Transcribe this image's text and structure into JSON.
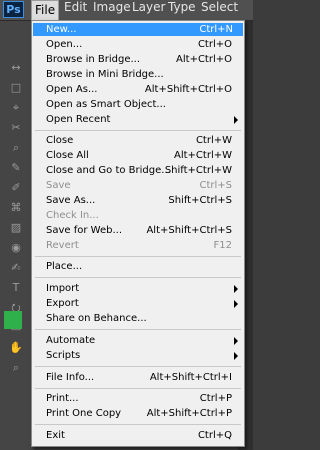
{
  "app_logo": "Ps",
  "menubar": {
    "items": [
      "File",
      "Edit",
      "Image",
      "Layer",
      "Type",
      "Select"
    ]
  },
  "toolbar_icons": [
    "↔",
    "□",
    "⌖",
    "✂",
    "⌕",
    "✎",
    "✐",
    "⌘",
    "▨",
    "◉",
    "✍",
    "T",
    "⭮",
    "▭",
    "✋",
    "⌕"
  ],
  "file_menu": {
    "items": [
      {
        "label": "New...",
        "shortcut": "Ctrl+N",
        "state": "highlighted"
      },
      {
        "label": "Open...",
        "shortcut": "Ctrl+O"
      },
      {
        "label": "Browse in Bridge...",
        "shortcut": "Alt+Ctrl+O"
      },
      {
        "label": "Browse in Mini Bridge...",
        "shortcut": ""
      },
      {
        "label": "Open As...",
        "shortcut": "Alt+Shift+Ctrl+O"
      },
      {
        "label": "Open as Smart Object...",
        "shortcut": ""
      },
      {
        "label": "Open Recent",
        "shortcut": "",
        "submenu": true
      },
      {
        "label": "Close",
        "shortcut": "Ctrl+W"
      },
      {
        "label": "Close All",
        "shortcut": "Alt+Ctrl+W"
      },
      {
        "label": "Close and Go to Bridge...",
        "shortcut": "Shift+Ctrl+W"
      },
      {
        "label": "Save",
        "shortcut": "Ctrl+S",
        "disabled": true
      },
      {
        "label": "Save As...",
        "shortcut": "Shift+Ctrl+S"
      },
      {
        "label": "Check In...",
        "shortcut": "",
        "disabled": true
      },
      {
        "label": "Save for Web...",
        "shortcut": "Alt+Shift+Ctrl+S"
      },
      {
        "label": "Revert",
        "shortcut": "F12",
        "disabled": true
      },
      {
        "label": "Place...",
        "shortcut": ""
      },
      {
        "label": "Import",
        "shortcut": "",
        "submenu": true
      },
      {
        "label": "Export",
        "shortcut": "",
        "submenu": true
      },
      {
        "label": "Share on Behance...",
        "shortcut": ""
      },
      {
        "label": "Automate",
        "shortcut": "",
        "submenu": true
      },
      {
        "label": "Scripts",
        "shortcut": "",
        "submenu": true
      },
      {
        "label": "File Info...",
        "shortcut": "Alt+Shift+Ctrl+I"
      },
      {
        "label": "Print...",
        "shortcut": "Ctrl+P"
      },
      {
        "label": "Print One Copy",
        "shortcut": "Alt+Shift+Ctrl+P"
      },
      {
        "label": "Exit",
        "shortcut": "Ctrl+Q"
      }
    ]
  },
  "colors": {
    "highlight": "#3399ff",
    "menu_bg": "#f0f0f0",
    "disabled_text": "#8e8e8e",
    "swatch": "#2fb04a"
  }
}
